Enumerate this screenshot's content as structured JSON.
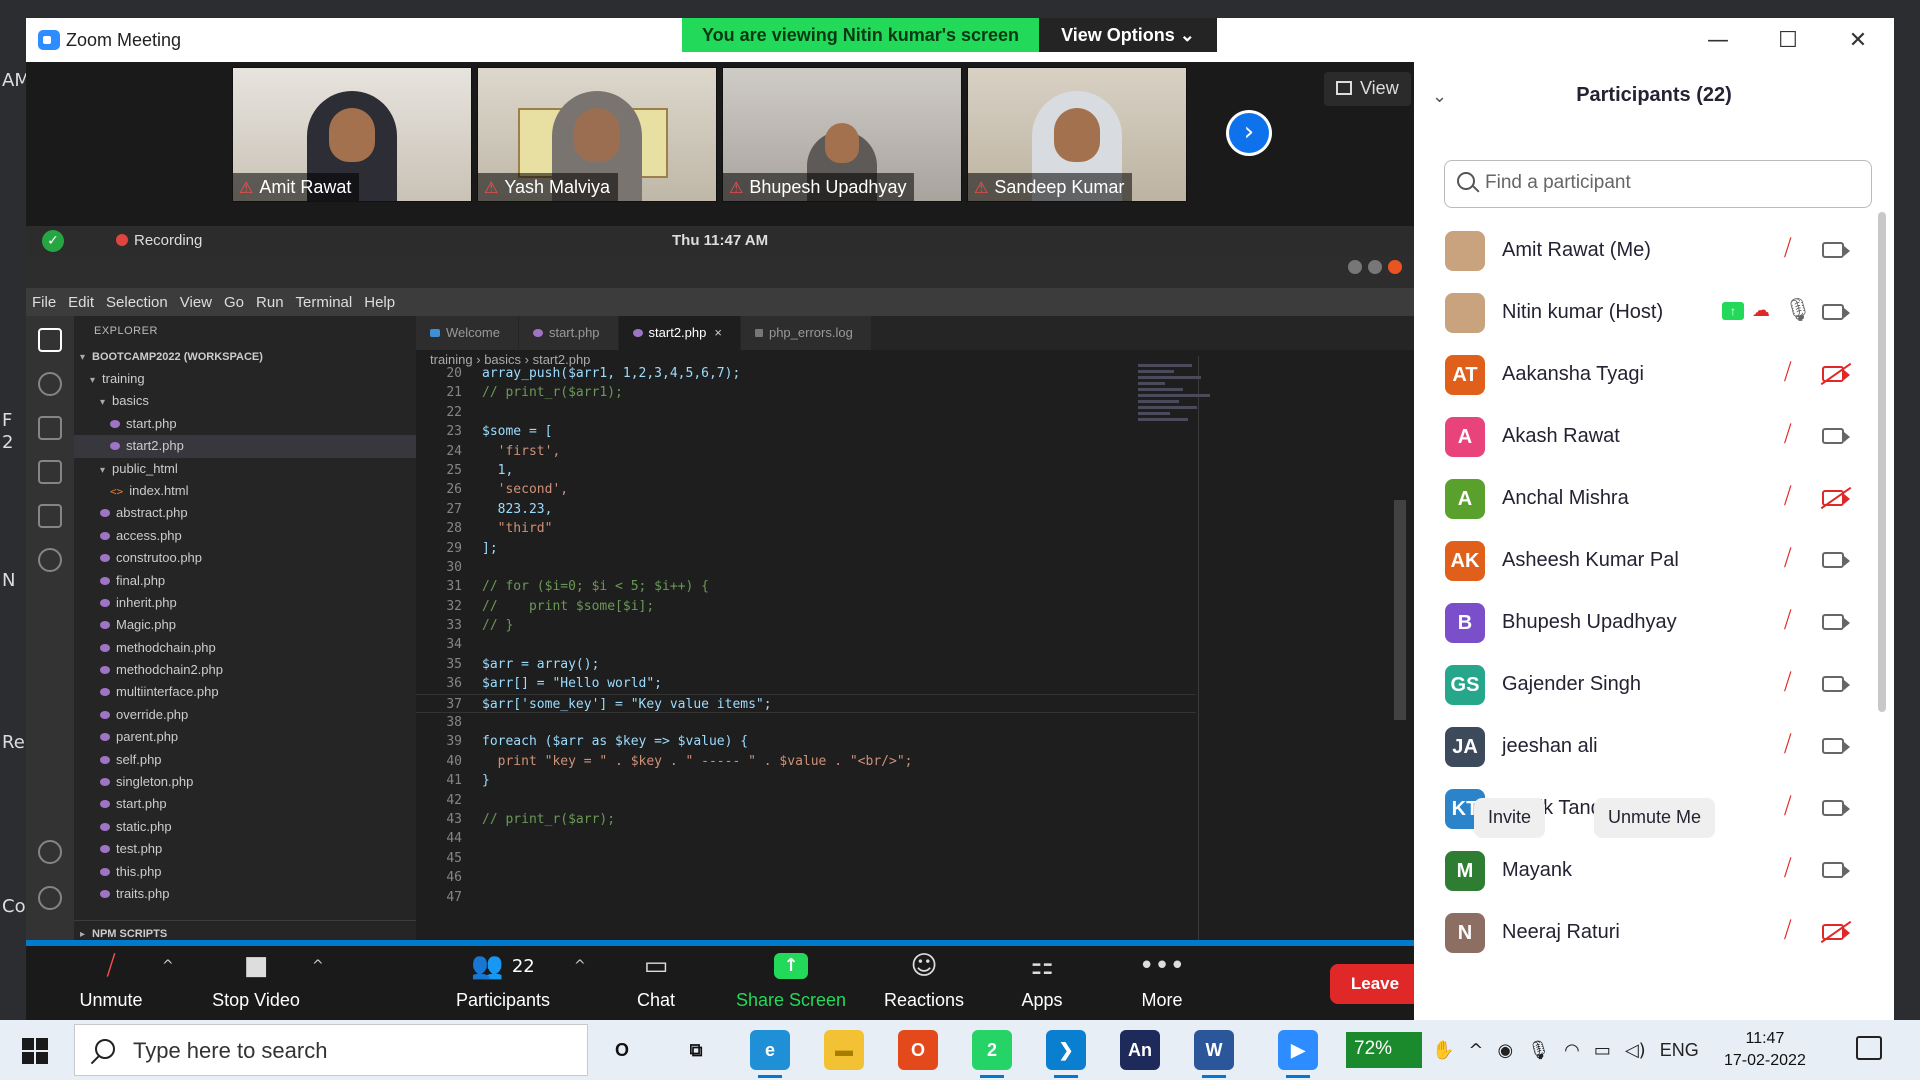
{
  "window": {
    "title": "Zoom Meeting",
    "minimize": "—",
    "maximize": "☐",
    "close": "✕"
  },
  "banner": {
    "viewing": "You are viewing Nitin kumar's screen",
    "view_options": "View Options ⌄"
  },
  "desktop": {
    "left_labels": [
      "AM",
      "F",
      "2",
      "N",
      "Re",
      "Co"
    ]
  },
  "video_tiles": [
    {
      "name": "Amit Rawat"
    },
    {
      "name": "Yash Malviya"
    },
    {
      "name": "Bhupesh Upadhyay"
    },
    {
      "name": "Sandeep Kumar"
    }
  ],
  "view_button": "View",
  "shared": {
    "recording": "Recording",
    "clock": "Thu 11:47 AM",
    "menu": [
      "File",
      "Edit",
      "Selection",
      "View",
      "Go",
      "Run",
      "Terminal",
      "Help"
    ],
    "explorer_title": "EXPLORER",
    "workspace": "BOOTCAMP2022 (WORKSPACE)",
    "tree": [
      {
        "label": "training",
        "kind": "folder",
        "indent": 1
      },
      {
        "label": "basics",
        "kind": "folder",
        "indent": 2
      },
      {
        "label": "start.php",
        "kind": "php",
        "indent": 3
      },
      {
        "label": "start2.php",
        "kind": "php",
        "indent": 3,
        "selected": true
      },
      {
        "label": "public_html",
        "kind": "folder",
        "indent": 2
      },
      {
        "label": "index.html",
        "kind": "html",
        "indent": 3
      },
      {
        "label": "abstract.php",
        "kind": "php",
        "indent": 2
      },
      {
        "label": "access.php",
        "kind": "php",
        "indent": 2
      },
      {
        "label": "construtoo.php",
        "kind": "php",
        "indent": 2
      },
      {
        "label": "final.php",
        "kind": "php",
        "indent": 2
      },
      {
        "label": "inherit.php",
        "kind": "php",
        "indent": 2
      },
      {
        "label": "Magic.php",
        "kind": "php",
        "indent": 2
      },
      {
        "label": "methodchain.php",
        "kind": "php",
        "indent": 2
      },
      {
        "label": "methodchain2.php",
        "kind": "php",
        "indent": 2
      },
      {
        "label": "multiinterface.php",
        "kind": "php",
        "indent": 2
      },
      {
        "label": "override.php",
        "kind": "php",
        "indent": 2
      },
      {
        "label": "parent.php",
        "kind": "php",
        "indent": 2
      },
      {
        "label": "self.php",
        "kind": "php",
        "indent": 2
      },
      {
        "label": "singleton.php",
        "kind": "php",
        "indent": 2
      },
      {
        "label": "start.php",
        "kind": "php",
        "indent": 2
      },
      {
        "label": "static.php",
        "kind": "php",
        "indent": 2
      },
      {
        "label": "test.php",
        "kind": "php",
        "indent": 2
      },
      {
        "label": "this.php",
        "kind": "php",
        "indent": 2
      },
      {
        "label": "traits.php",
        "kind": "php",
        "indent": 2
      }
    ],
    "npm_scripts": "NPM SCRIPTS",
    "tabs": [
      {
        "label": "Welcome",
        "cls": "welcome"
      },
      {
        "label": "start.php",
        "cls": ""
      },
      {
        "label": "start2.php",
        "cls": "active"
      },
      {
        "label": "php_errors.log",
        "cls": "log"
      }
    ],
    "breadcrumb": "training  ›  basics  ›  start2.php",
    "code": [
      {
        "n": "20",
        "t": "array_push($arr1, 1,2,3,4,5,6,7);"
      },
      {
        "n": "21",
        "t": "// print_r($arr1);"
      },
      {
        "n": "22",
        "t": ""
      },
      {
        "n": "23",
        "t": "$some = ["
      },
      {
        "n": "24",
        "t": "  'first',"
      },
      {
        "n": "25",
        "t": "  1,"
      },
      {
        "n": "26",
        "t": "  'second',"
      },
      {
        "n": "27",
        "t": "  823.23,"
      },
      {
        "n": "28",
        "t": "  \"third\""
      },
      {
        "n": "29",
        "t": "];"
      },
      {
        "n": "30",
        "t": ""
      },
      {
        "n": "31",
        "t": "// for ($i=0; $i < 5; $i++) {"
      },
      {
        "n": "32",
        "t": "//    print $some[$i];"
      },
      {
        "n": "33",
        "t": "// }"
      },
      {
        "n": "34",
        "t": ""
      },
      {
        "n": "35",
        "t": "$arr = array();"
      },
      {
        "n": "36",
        "t": "$arr[] = \"Hello world\";"
      },
      {
        "n": "37",
        "t": "$arr['some_key'] = \"Key value items\";"
      },
      {
        "n": "38",
        "t": ""
      },
      {
        "n": "39",
        "t": "foreach ($arr as $key => $value) {"
      },
      {
        "n": "40",
        "t": "  print \"key = \" . $key . \" ----- \" . $value . \"<br/>\";"
      },
      {
        "n": "41",
        "t": "}"
      },
      {
        "n": "42",
        "t": ""
      },
      {
        "n": "43",
        "t": "// print_r($arr);"
      },
      {
        "n": "44",
        "t": ""
      },
      {
        "n": "45",
        "t": ""
      },
      {
        "n": "46",
        "t": ""
      },
      {
        "n": "47",
        "t": ""
      }
    ]
  },
  "toolbar": {
    "unmute": "Unmute",
    "stop_video": "Stop Video",
    "participants": "Participants",
    "participants_count": "22",
    "chat": "Chat",
    "share_screen": "Share Screen",
    "reactions": "Reactions",
    "apps": "Apps",
    "more": "More",
    "leave": "Leave"
  },
  "panel": {
    "title": "Participants (22)",
    "search_placeholder": "Find a participant",
    "invite": "Invite",
    "unmute_me": "Unmute Me",
    "participants": [
      {
        "name": "Amit Rawat (Me)",
        "initials": "",
        "color": "",
        "photo": true,
        "cam_off": false
      },
      {
        "name": "Nitin kumar (Host)",
        "initials": "",
        "color": "",
        "photo": true,
        "host": true,
        "cam_off": false
      },
      {
        "name": "Aakansha Tyagi",
        "initials": "AT",
        "color": "#e0601b",
        "cam_off": true
      },
      {
        "name": "Akash Rawat",
        "initials": "A",
        "color": "#e8437a",
        "cam_off": false
      },
      {
        "name": "Anchal Mishra",
        "initials": "A",
        "color": "#5aa02c",
        "cam_off": true
      },
      {
        "name": "Asheesh Kumar Pal",
        "initials": "AK",
        "color": "#e0601b",
        "cam_off": false
      },
      {
        "name": "Bhupesh Upadhyay",
        "initials": "B",
        "color": "#7a4fc9",
        "cam_off": false
      },
      {
        "name": "Gajender Singh",
        "initials": "GS",
        "color": "#26a68a",
        "cam_off": false
      },
      {
        "name": "jeeshan ali",
        "initials": "JA",
        "color": "#3d4a5c",
        "cam_off": false
      },
      {
        "name": "Kartik Tandon",
        "initials": "KT",
        "color": "#2b84c9",
        "cam_off": false
      },
      {
        "name": "Mayank",
        "initials": "M",
        "color": "#2e7d32",
        "cam_off": false
      },
      {
        "name": "Neeraj Raturi",
        "initials": "N",
        "color": "#8d6e63",
        "cam_off": true
      }
    ]
  },
  "taskbar": {
    "search_placeholder": "Type here to search",
    "battery": "72%",
    "language": "ENG",
    "time": "11:47",
    "date": "17-02-2022",
    "apps": [
      {
        "name": "cortana",
        "label": "O",
        "color": "#e8eef6",
        "fg": "#111"
      },
      {
        "name": "task-view",
        "label": "⧉",
        "color": "#e8eef6",
        "fg": "#111"
      },
      {
        "name": "edge",
        "label": "e",
        "color": "#1f8fd6",
        "fg": "#fff"
      },
      {
        "name": "file-explorer",
        "label": "▬",
        "color": "#f3c234",
        "fg": "#a77d00"
      },
      {
        "name": "office",
        "label": "O",
        "color": "#e4491c",
        "fg": "#fff"
      },
      {
        "name": "whatsapp",
        "label": "2",
        "color": "#25d366",
        "fg": "#fff"
      },
      {
        "name": "vscode",
        "label": "❯",
        "color": "#0a7fd0",
        "fg": "#fff"
      },
      {
        "name": "animate",
        "label": "An",
        "color": "#1e2a5a",
        "fg": "#fff"
      },
      {
        "name": "word",
        "label": "W",
        "color": "#2b579a",
        "fg": "#fff"
      },
      {
        "name": "zoom",
        "label": "▶",
        "color": "#2d8cff",
        "fg": "#fff"
      }
    ]
  }
}
